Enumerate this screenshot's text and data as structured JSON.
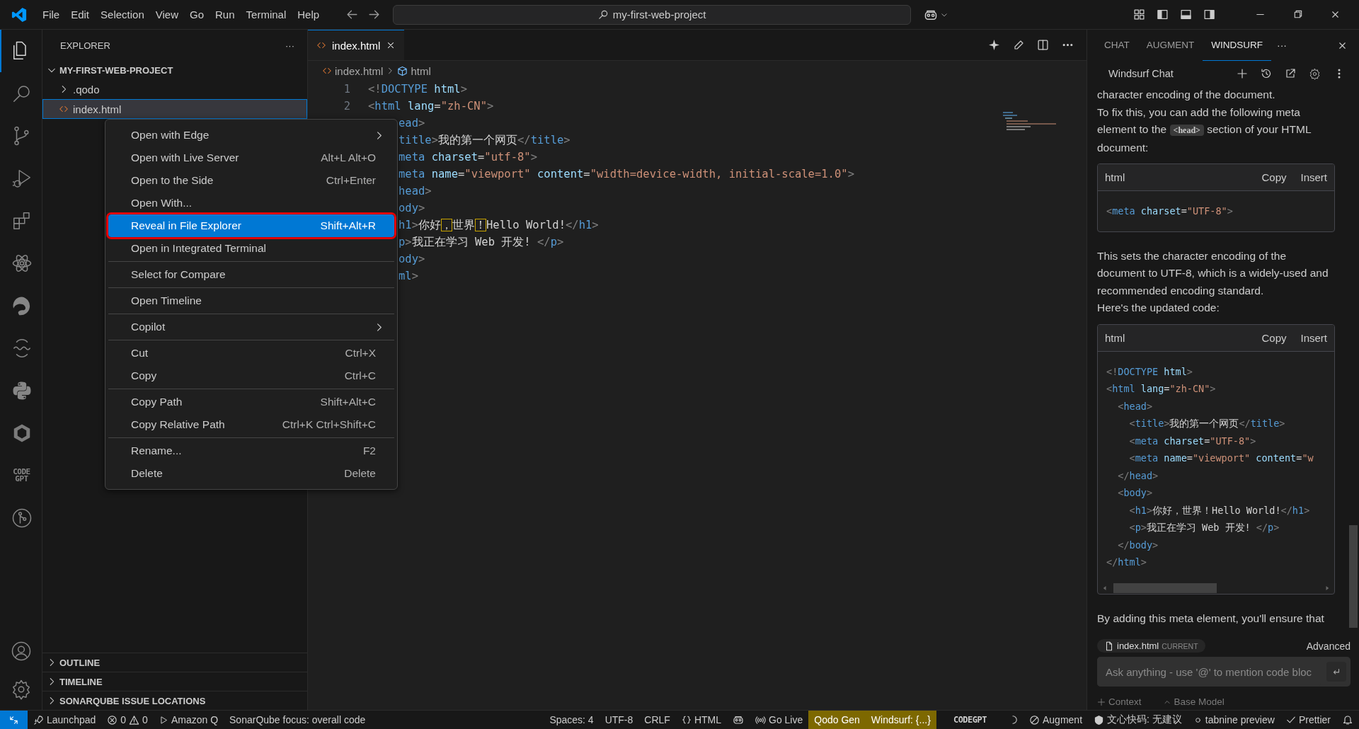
{
  "menu_bar": [
    "File",
    "Edit",
    "Selection",
    "View",
    "Go",
    "Run",
    "Terminal",
    "Help"
  ],
  "command_center": {
    "text": "my-first-web-project"
  },
  "activity_bar": [
    {
      "kind": "files",
      "selected": true
    },
    {
      "kind": "search",
      "selected": false
    },
    {
      "kind": "git",
      "selected": false
    },
    {
      "kind": "debug",
      "selected": false
    },
    {
      "kind": "extensions",
      "selected": false
    },
    {
      "kind": "atom",
      "selected": false
    },
    {
      "kind": "swirl",
      "selected": false
    },
    {
      "kind": "wave",
      "selected": false
    },
    {
      "kind": "python",
      "selected": false
    },
    {
      "kind": "cube",
      "selected": false
    },
    {
      "kind": "codegpt",
      "label": "CODE GPT",
      "selected": false
    },
    {
      "kind": "graph",
      "selected": false
    }
  ],
  "sidebar": {
    "title": "EXPLORER",
    "more": "···",
    "project": {
      "name": "MY-FIRST-WEB-PROJECT",
      "expanded": true
    },
    "items": [
      {
        "kind": "folder",
        "name": ".qodo",
        "expanded": false,
        "selected": false
      },
      {
        "kind": "html",
        "name": "index.html",
        "selected": true
      }
    ],
    "sections": [
      {
        "name": "OUTLINE",
        "expanded": false
      },
      {
        "name": "TIMELINE",
        "expanded": false
      },
      {
        "name": "SONARQUBE ISSUE LOCATIONS",
        "expanded": false
      }
    ]
  },
  "editor": {
    "tabs": [
      {
        "name": "index.html",
        "selected": true
      }
    ],
    "breadcrumb": [
      "index.html",
      "html"
    ],
    "lines": [
      {
        "number": "1",
        "tokens": [
          {
            "kind": "p",
            "text": "<!"
          },
          {
            "kind": "tag",
            "text": "DOCTYPE"
          },
          {
            "kind": "attr",
            "text": " html"
          },
          {
            "kind": "p",
            "text": ">"
          }
        ]
      },
      {
        "number": "2",
        "tokens": [
          {
            "kind": "p",
            "text": "<"
          },
          {
            "kind": "tag",
            "text": "html"
          },
          {
            "kind": "attr",
            "text": " lang"
          },
          {
            "kind": "text",
            "text": "="
          },
          {
            "kind": "str",
            "text": "\"zh-CN\""
          },
          {
            "kind": "p",
            "text": ">"
          }
        ]
      },
      {
        "tokens": [
          {
            "kind": "tag",
            "text": "ead"
          },
          {
            "kind": "p",
            "text": ">"
          }
        ]
      },
      {
        "tokens": [
          {
            "kind": "tag",
            "text": "title"
          },
          {
            "kind": "p",
            "text": ">"
          },
          {
            "kind": "text",
            "text": "我的第一个网页"
          },
          {
            "kind": "p",
            "text": "</"
          },
          {
            "kind": "tag",
            "text": "title"
          },
          {
            "kind": "p",
            "text": ">"
          }
        ]
      },
      {
        "tokens": [
          {
            "kind": "tag",
            "text": "meta"
          },
          {
            "kind": "attr",
            "text": " charset"
          },
          {
            "kind": "text",
            "text": "="
          },
          {
            "kind": "str",
            "text": "\"utf-8\""
          },
          {
            "kind": "p",
            "text": ">"
          }
        ]
      },
      {
        "tokens": [
          {
            "kind": "tag",
            "text": "meta"
          },
          {
            "kind": "attr",
            "text": " name"
          },
          {
            "kind": "text",
            "text": "="
          },
          {
            "kind": "str",
            "text": "\"viewport\""
          },
          {
            "kind": "attr",
            "text": " content"
          },
          {
            "kind": "text",
            "text": "="
          },
          {
            "kind": "str",
            "text": "\"width=device-width, initial-scale=1.0\""
          },
          {
            "kind": "p",
            "text": ">"
          }
        ]
      },
      {
        "tokens": [
          {
            "kind": "tag",
            "text": "head"
          },
          {
            "kind": "p",
            "text": ">"
          }
        ]
      },
      {
        "tokens": [
          {
            "kind": "tag",
            "text": "ody"
          },
          {
            "kind": "p",
            "text": ">"
          }
        ]
      },
      {
        "tokens": [
          {
            "kind": "tag",
            "text": "h1"
          },
          {
            "kind": "p",
            "text": ">"
          },
          {
            "kind": "text",
            "text": "你好"
          },
          {
            "kind": "warn",
            "text": "，"
          },
          {
            "kind": "text",
            "text": "世界"
          },
          {
            "kind": "warn",
            "text": "！"
          },
          {
            "kind": "text",
            "text": "Hello World!"
          },
          {
            "kind": "p",
            "text": "</"
          },
          {
            "kind": "tag",
            "text": "h1"
          },
          {
            "kind": "p",
            "text": ">"
          }
        ]
      },
      {
        "tokens": [
          {
            "kind": "tag",
            "text": "p"
          },
          {
            "kind": "p",
            "text": ">"
          },
          {
            "kind": "text",
            "text": "我正在学习 Web 开发! "
          },
          {
            "kind": "p",
            "text": "</"
          },
          {
            "kind": "tag",
            "text": "p"
          },
          {
            "kind": "p",
            "text": ">"
          }
        ]
      },
      {
        "tokens": [
          {
            "kind": "tag",
            "text": "ody"
          },
          {
            "kind": "p",
            "text": ">"
          }
        ]
      },
      {
        "tokens": [
          {
            "kind": "tag",
            "text": "ml"
          },
          {
            "kind": "p",
            "text": ">"
          }
        ]
      }
    ]
  },
  "context_menu": {
    "groups": [
      [
        {
          "label": "Open with Edge",
          "submenu": true,
          "selected": false
        },
        {
          "label": "Open with Live Server",
          "shortcut": "Alt+L Alt+O",
          "submenu": false,
          "selected": false
        },
        {
          "label": "Open to the Side",
          "shortcut": "Ctrl+Enter",
          "submenu": false,
          "selected": false
        },
        {
          "label": "Open With...",
          "submenu": false,
          "selected": false
        },
        {
          "label": "Reveal in File Explorer",
          "shortcut": "Shift+Alt+R",
          "submenu": false,
          "selected": true
        },
        {
          "label": "Open in Integrated Terminal",
          "submenu": false,
          "selected": false
        }
      ],
      [
        {
          "label": "Select for Compare",
          "submenu": false,
          "selected": false
        }
      ],
      [
        {
          "label": "Open Timeline",
          "submenu": false,
          "selected": false
        }
      ],
      [
        {
          "label": "Copilot",
          "submenu": true,
          "selected": false
        }
      ],
      [
        {
          "label": "Cut",
          "shortcut": "Ctrl+X",
          "submenu": false,
          "selected": false
        },
        {
          "label": "Copy",
          "shortcut": "Ctrl+C",
          "submenu": false,
          "selected": false
        }
      ],
      [
        {
          "label": "Copy Path",
          "shortcut": "Shift+Alt+C",
          "submenu": false,
          "selected": false
        },
        {
          "label": "Copy Relative Path",
          "shortcut": "Ctrl+K Ctrl+Shift+C",
          "submenu": false,
          "selected": false
        }
      ],
      [
        {
          "label": "Rename...",
          "shortcut": "F2",
          "submenu": false,
          "selected": false
        },
        {
          "label": "Delete",
          "shortcut": "Delete",
          "submenu": false,
          "selected": false
        }
      ]
    ]
  },
  "chat_panel": {
    "tabs": [
      {
        "label": "CHAT",
        "selected": false
      },
      {
        "label": "AUGMENT",
        "selected": false
      },
      {
        "label": "WINDSURF",
        "selected": true
      }
    ],
    "more": "···",
    "title": "Windsurf Chat",
    "messages": [
      {
        "kind": "text",
        "text": "character encoding of the document."
      },
      {
        "kind": "inline",
        "before": "To fix this, you can add the following meta element to the ",
        "code": "<head>",
        "after": " section of your HTML document:"
      },
      {
        "kind": "code",
        "language": "html",
        "buttons": [
          "Copy",
          "Insert"
        ],
        "lines": [
          [
            {
              "kind": "p",
              "text": "<"
            },
            {
              "kind": "tag",
              "text": "meta"
            },
            {
              "kind": "attr",
              "text": " charset"
            },
            {
              "kind": "text",
              "text": "="
            },
            {
              "kind": "str",
              "text": "\"UTF-8\""
            },
            {
              "kind": "p",
              "text": ">"
            }
          ]
        ]
      },
      {
        "kind": "text",
        "text": "This sets the character encoding of the document to UTF-8, which is a widely-used and recommended encoding standard."
      },
      {
        "kind": "text",
        "text": "Here's the updated code:"
      },
      {
        "kind": "code",
        "language": "html",
        "buttons": [
          "Copy",
          "Insert"
        ],
        "lines": [
          [
            {
              "kind": "p",
              "text": "<!"
            },
            {
              "kind": "tag",
              "text": "DOCTYPE"
            },
            {
              "kind": "attr",
              "text": " html"
            },
            {
              "kind": "p",
              "text": ">"
            }
          ],
          [
            {
              "kind": "p",
              "text": "<"
            },
            {
              "kind": "tag",
              "text": "html"
            },
            {
              "kind": "attr",
              "text": " lang"
            },
            {
              "kind": "text",
              "text": "="
            },
            {
              "kind": "str",
              "text": "\"zh-CN\""
            },
            {
              "kind": "p",
              "text": ">"
            }
          ],
          [
            {
              "kind": "p",
              "text": "  <"
            },
            {
              "kind": "tag",
              "text": "head"
            },
            {
              "kind": "p",
              "text": ">"
            }
          ],
          [
            {
              "kind": "p",
              "text": "    <"
            },
            {
              "kind": "tag",
              "text": "title"
            },
            {
              "kind": "p",
              "text": ">"
            },
            {
              "kind": "text",
              "text": "我的第一个网页"
            },
            {
              "kind": "p",
              "text": "</"
            },
            {
              "kind": "tag",
              "text": "title"
            },
            {
              "kind": "p",
              "text": ">"
            }
          ],
          [
            {
              "kind": "p",
              "text": "    <"
            },
            {
              "kind": "tag",
              "text": "meta"
            },
            {
              "kind": "attr",
              "text": " charset"
            },
            {
              "kind": "text",
              "text": "="
            },
            {
              "kind": "str",
              "text": "\"UTF-8\""
            },
            {
              "kind": "p",
              "text": ">"
            }
          ],
          [
            {
              "kind": "p",
              "text": "    <"
            },
            {
              "kind": "tag",
              "text": "meta"
            },
            {
              "kind": "attr",
              "text": " name"
            },
            {
              "kind": "text",
              "text": "="
            },
            {
              "kind": "str",
              "text": "\"viewport\""
            },
            {
              "kind": "attr",
              "text": " content"
            },
            {
              "kind": "text",
              "text": "="
            },
            {
              "kind": "str",
              "text": "\"w"
            }
          ],
          [
            {
              "kind": "p",
              "text": "  </"
            },
            {
              "kind": "tag",
              "text": "head"
            },
            {
              "kind": "p",
              "text": ">"
            }
          ],
          [
            {
              "kind": "p",
              "text": "  <"
            },
            {
              "kind": "tag",
              "text": "body"
            },
            {
              "kind": "p",
              "text": ">"
            }
          ],
          [
            {
              "kind": "p",
              "text": "    <"
            },
            {
              "kind": "tag",
              "text": "h1"
            },
            {
              "kind": "p",
              "text": ">"
            },
            {
              "kind": "text",
              "text": "你好，世界！Hello World!"
            },
            {
              "kind": "p",
              "text": "</"
            },
            {
              "kind": "tag",
              "text": "h1"
            },
            {
              "kind": "p",
              "text": ">"
            }
          ],
          [
            {
              "kind": "p",
              "text": "    <"
            },
            {
              "kind": "tag",
              "text": "p"
            },
            {
              "kind": "p",
              "text": ">"
            },
            {
              "kind": "text",
              "text": "我正在学习 Web 开发! "
            },
            {
              "kind": "p",
              "text": "</"
            },
            {
              "kind": "tag",
              "text": "p"
            },
            {
              "kind": "p",
              "text": ">"
            }
          ],
          [
            {
              "kind": "p",
              "text": "  </"
            },
            {
              "kind": "tag",
              "text": "body"
            },
            {
              "kind": "p",
              "text": ">"
            }
          ],
          [
            {
              "kind": "p",
              "text": "</"
            },
            {
              "kind": "tag",
              "text": "html"
            },
            {
              "kind": "p",
              "text": ">"
            }
          ]
        ]
      },
      {
        "kind": "text",
        "text": "By adding this meta element, you'll ensure that"
      }
    ],
    "context_chip": {
      "file": "index.html",
      "tag": "CURRENT"
    },
    "advanced": "Advanced",
    "input": {
      "placeholder": "Ask anything - use '@' to mention code bloc"
    },
    "footer": [
      "Context",
      "Base Model"
    ]
  },
  "status_bar": {
    "left": [
      {
        "kind": "remote",
        "highlighted": true
      },
      {
        "kind": "launchpad",
        "text": "Launchpad",
        "highlighted": false
      },
      {
        "kind": "problems",
        "errors": "0",
        "warnings": "0",
        "highlighted": false
      },
      {
        "kind": "amazonq",
        "text": "Amazon Q",
        "highlighted": false
      },
      {
        "kind": "plain",
        "text": "SonarQube focus: overall code",
        "highlighted": false
      }
    ],
    "right": [
      {
        "kind": "plain",
        "text": "Spaces: 4",
        "highlighted": false
      },
      {
        "kind": "plain",
        "text": "UTF-8",
        "highlighted": false
      },
      {
        "kind": "plain",
        "text": "CRLF",
        "highlighted": false
      },
      {
        "kind": "language",
        "text": "HTML",
        "highlighted": false
      },
      {
        "kind": "copilot",
        "highlighted": false
      },
      {
        "kind": "golive",
        "text": "Go Live",
        "highlighted": false
      },
      {
        "kind": "plain",
        "text": "Qodo Gen",
        "highlighted": true
      },
      {
        "kind": "plain",
        "text": "Windsurf: {...}",
        "highlighted": true
      },
      {
        "kind": "logo",
        "text": "CODEGPT",
        "highlighted": false
      },
      {
        "kind": "spinner",
        "highlighted": false
      },
      {
        "kind": "augment",
        "text": "Augment",
        "highlighted": false
      },
      {
        "kind": "wenxin",
        "text": "文心快码: 无建议",
        "highlighted": false
      },
      {
        "kind": "tabnine",
        "text": "tabnine preview",
        "highlighted": false
      },
      {
        "kind": "prettier",
        "text": "Prettier",
        "highlighted": false
      },
      {
        "kind": "bell",
        "highlighted": false
      }
    ]
  }
}
